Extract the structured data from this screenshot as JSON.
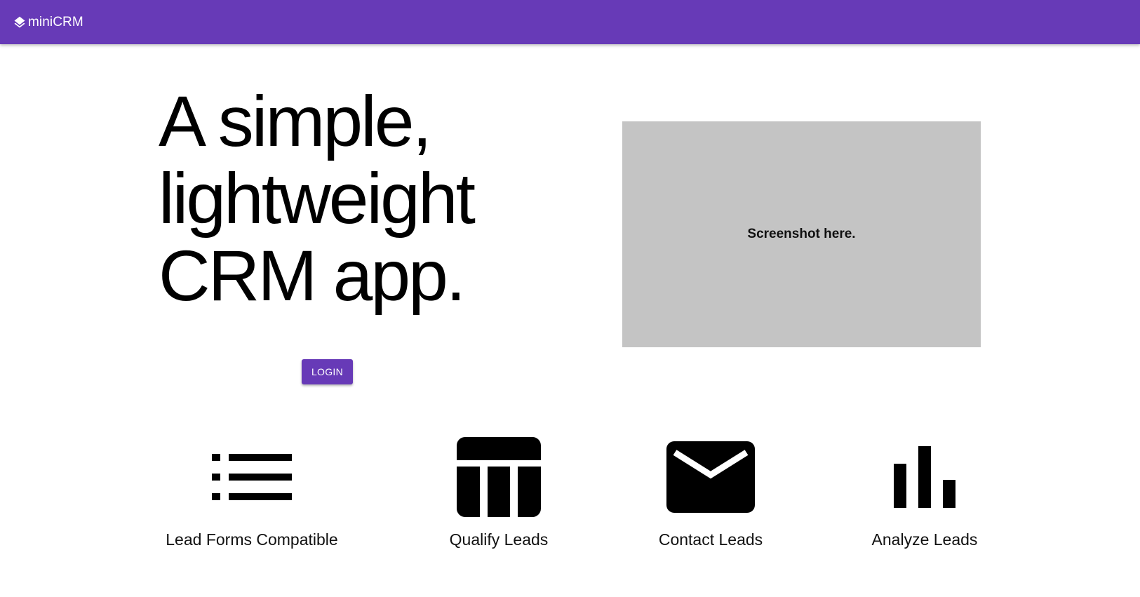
{
  "app": {
    "brand_name": "miniCRM",
    "brand_icon": "layers-icon",
    "accent_color": "#673ab7"
  },
  "hero": {
    "title_lines": [
      "A simple,",
      "lightweight",
      "CRM app."
    ],
    "login_label": "LOGIN",
    "screenshot_placeholder": "Screenshot here.",
    "placeholder_color": "#c4c4c4"
  },
  "features": [
    {
      "label": "Lead Forms Compatible",
      "icon": "list-icon"
    },
    {
      "label": "Qualify Leads",
      "icon": "table-icon"
    },
    {
      "label": "Contact Leads",
      "icon": "mail-icon"
    },
    {
      "label": "Analyze Leads",
      "icon": "bar-chart-icon"
    }
  ]
}
